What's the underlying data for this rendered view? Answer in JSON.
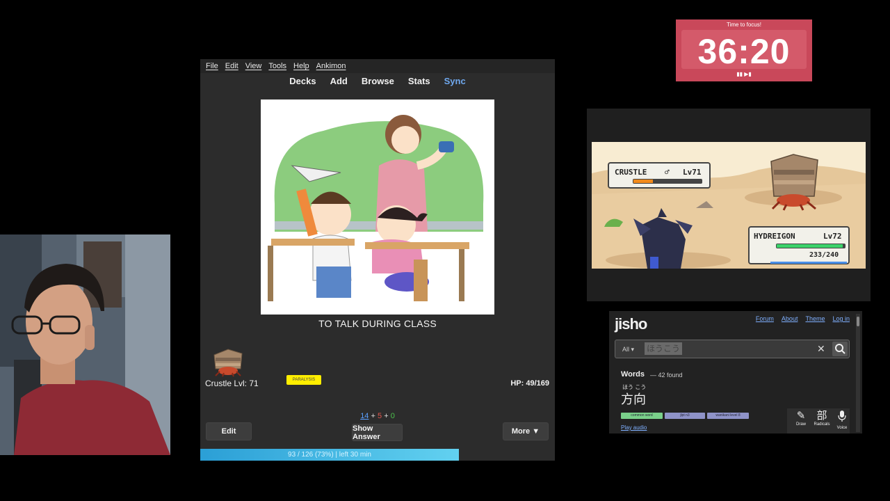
{
  "anki": {
    "menu": [
      "File",
      "Edit",
      "View",
      "Tools",
      "Help",
      "Ankimon"
    ],
    "toolbar": {
      "decks": "Decks",
      "add": "Add",
      "browse": "Browse",
      "stats": "Stats",
      "sync": "Sync"
    },
    "card": {
      "answer_text": "TO TALK DURING CLASS"
    },
    "ankimon": {
      "monster_label": "Crustle Lvl: 71",
      "status": "PARALYSIS",
      "hp_label": "HP: 49/169"
    },
    "counts": {
      "new": "14",
      "plus1": "+",
      "learning": "5",
      "plus2": "+",
      "review": "0"
    },
    "buttons": {
      "edit": "Edit",
      "show_answer": "Show Answer",
      "more": "More ▼"
    },
    "progress": {
      "fraction": 0.73,
      "text": "93 / 126 (73%) | left 30 min"
    }
  },
  "timer": {
    "title": "Time to focus!",
    "value": "36:20",
    "controls": "▮▮ ▶▮"
  },
  "battle": {
    "enemy": {
      "name": "CRUSTLE",
      "gender": "♂",
      "level": "Lv71",
      "hp_fraction": 0.29
    },
    "player": {
      "name": "HYDREIGON",
      "level": "Lv72",
      "hp_text": "233/240",
      "hp_fraction": 0.97
    }
  },
  "jisho": {
    "logo": "jisho",
    "nav": {
      "forum": "Forum",
      "about": "About",
      "theme": "Theme",
      "login": "Log in"
    },
    "search": {
      "filter": "All ▾",
      "query": "ほうこう"
    },
    "results": {
      "heading": "Words",
      "count": "— 42 found"
    },
    "word": {
      "furigana": "ほう こう",
      "kanji": "方向"
    },
    "tags": {
      "common": "common word",
      "jlpt": "jlpt n3",
      "wanikani": "wanikani level 8"
    },
    "play_audio": "Play audio",
    "tools": {
      "draw": "Draw",
      "radicals": "Radicals",
      "radicals_glyph": "部",
      "voice": "Voice"
    }
  },
  "colors": {
    "progress": "#2b9fd6",
    "status_badge": "#ffee00",
    "timer_bg": "#c9485a",
    "link": "#7fb0ff"
  }
}
